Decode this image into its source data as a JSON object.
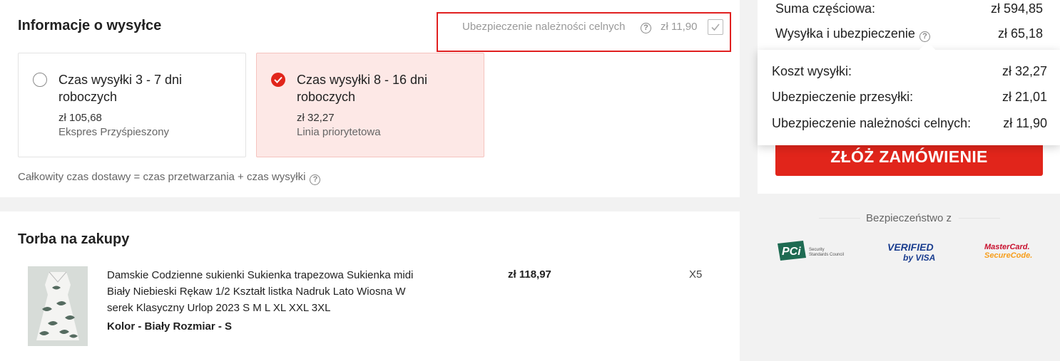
{
  "shipping": {
    "title": "Informacje o wysyłce",
    "customs": {
      "label": "Ubezpieczenie należności celnych",
      "price": "zł 11,90",
      "checked": true
    },
    "options": [
      {
        "name": "Czas wysyłki 3 - 7 dni roboczych",
        "price": "zł 105,68",
        "method": "Ekspres Przyśpieszony",
        "selected": false
      },
      {
        "name": "Czas wysyłki 8 - 16 dni roboczych",
        "price": "zł 32,27",
        "method": "Linia priorytetowa",
        "selected": true
      }
    ],
    "delivery_note": "Całkowity czas dostawy = czas przetwarzania + czas wysyłki"
  },
  "bag": {
    "title": "Torba na zakupy",
    "items": [
      {
        "description": "Damskie Codzienne sukienki Sukienka trapezowa Sukienka midi Biały Niebieski Rękaw 1/2 Kształt listka Nadruk Lato Wiosna W serek Klasyczny Urlop 2023 S M L XL XXL 3XL",
        "variant": "Kolor - Biały  Rozmiar - S",
        "price": "zł 118,97",
        "quantity": "X5"
      }
    ]
  },
  "summary": {
    "subtotal_label": "Suma częściowa:",
    "subtotal_value": "zł 594,85",
    "shipping_label": "Wysyłka i ubezpieczenie",
    "shipping_value": "zł 65,18",
    "order_button": "ZŁÓŻ ZAMÓWIENIE",
    "breakdown": [
      {
        "label": "Koszt wysyłki:",
        "value": "zł 32,27"
      },
      {
        "label": "Ubezpieczenie przesyłki:",
        "value": "zł 21,01"
      },
      {
        "label": "Ubezpieczenie należności celnych:",
        "value": "zł 11,90"
      }
    ]
  },
  "security": {
    "title": "Bezpieczeństwo z",
    "logos": [
      {
        "name": "pci-logo",
        "text": "PCi",
        "subtext": "Security Standards Council"
      },
      {
        "name": "verified-by-visa-logo",
        "text": "VERIFIED",
        "subtext": "by VISA"
      },
      {
        "name": "mastercard-securecode-logo",
        "text": "MasterCard.",
        "subtext": "SecureCode."
      }
    ]
  },
  "colors": {
    "accent": "#e1251b",
    "selected_bg": "#fde8e6",
    "highlight_border": "#e02020"
  },
  "icons": [
    "help-icon",
    "checkbox-check-icon",
    "radio-checked-icon",
    "radio-unchecked-icon"
  ]
}
